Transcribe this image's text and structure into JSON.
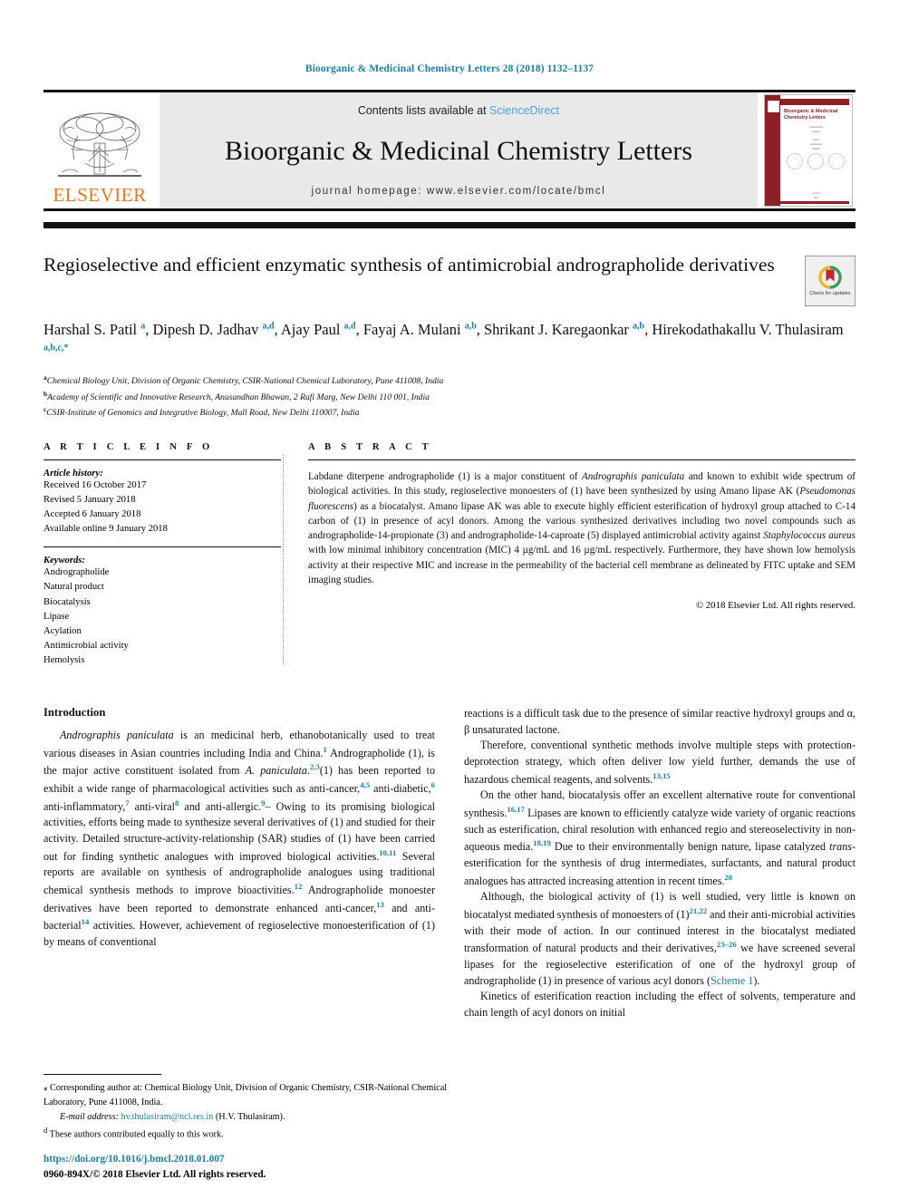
{
  "running_head": "Bioorganic & Medicinal Chemistry Letters 28 (2018) 1132–1137",
  "masthead": {
    "contents_prefix": "Contents lists available at ",
    "sciencedirect": "ScienceDirect",
    "journal_title": "Bioorganic & Medicinal Chemistry Letters",
    "homepage": "journal homepage: www.elsevier.com/locate/bmcl",
    "publisher_wordmark": "ELSEVIER",
    "publisher_color": "#E87722",
    "cover": {
      "title": "Bioorganic & Medicinal Chemistry Letters",
      "accent_color": "#8d2024"
    }
  },
  "article": {
    "title": "Regioselective and efficient enzymatic synthesis of antimicrobial andrographolide derivatives",
    "crossmark_label": "Check for updates",
    "authors_html": "Harshal S. Patil <sup>a</sup>, Dipesh D. Jadhav <sup>a,d</sup>, Ajay Paul <sup>a,d</sup>, Fayaj A. Mulani <sup>a,b</sup>, Shrikant J. Karegaonkar <sup>a,b</sup>, Hirekodathakallu V. Thulasiram <sup>a,b,c,</sup><sup>*</sup>",
    "affiliations": [
      {
        "mark": "a",
        "text": "Chemical Biology Unit, Division of Organic Chemistry, CSIR-National Chemical Laboratory, Pune 411008, India"
      },
      {
        "mark": "b",
        "text": "Academy of Scientific and Innovative Research, Anusandhan Bhawan, 2 Rafi Marg, New Delhi 110 001, India"
      },
      {
        "mark": "c",
        "text": "CSIR-Institute of Genomics and Integrative Biology, Mall Road, New Delhi 110007, India"
      }
    ]
  },
  "article_info": {
    "heading": "A R T I C L E   I N F O",
    "history_label": "Article history:",
    "history": [
      "Received 16 October 2017",
      "Revised 5 January 2018",
      "Accepted 6 January 2018",
      "Available online 9 January 2018"
    ],
    "keywords_label": "Keywords:",
    "keywords": [
      "Andrographolide",
      "Natural product",
      "Biocatalysis",
      "Lipase",
      "Acylation",
      "Antimicrobial activity",
      "Hemolysis"
    ]
  },
  "abstract": {
    "heading": "A B S T R A C T",
    "body_html": "Labdane diterpene andrographolide (1) is a major constituent of <i>Andrographis paniculata</i> and known to exhibit wide spectrum of biological activities. In this study, regioselective monoesters of (1) have been synthesized by using Amano lipase AK (<i>Pseudomonas fluorescens</i>) as a biocatalyst. Amano lipase AK was able to execute highly efficient esterification of hydroxyl group attached to C-14 carbon of (1) in presence of acyl donors. Among the various synthesized derivatives including two novel compounds such as andrographolide-14-propionate (3) and andrographolide-14-caproate (5) displayed antimicrobial activity against <i>Staphylococcus aureus</i> with low minimal inhibitory concentration (MIC) 4 µg/mL and 16 µg/mL respectively. Furthermore, they have shown low hemolysis activity at their respective MIC and increase in the permeability of the bacterial cell membrane as delineated by FITC uptake and SEM imaging studies.",
    "copyright": "© 2018 Elsevier Ltd. All rights reserved."
  },
  "body": {
    "section_heading": "Introduction",
    "left_paragraphs_html": [
      "<i>Andrographis paniculata</i> is an medicinal herb, ethanobotanically used to treat various diseases in Asian countries including India and China.<span class=\"ref\">1</span> Andrographolide (1), is the major active constituent isolated from <i>A. paniculata</i>.<span class=\"ref\">2,3</span>(1) has been reported to exhibit a wide range of pharmacological activities such as anti-cancer,<span class=\"ref\">4,5</span> anti-diabetic,<span class=\"ref\">6</span> anti-inflammatory,<span class=\"ref\">7</span> anti-viral<span class=\"ref\">8</span> and anti-allergic.<span class=\"ref\">9</span>– Owing to its promising biological activities, efforts being made to synthesize several derivatives of (1) and studied for their activity. Detailed structure-activity-relationship (SAR) studies of (1) have been carried out for finding synthetic analogues with improved biological activities.<span class=\"ref\">10,11</span> Several reports are available on synthesis of andrographolide analogues using traditional chemical synthesis methods to improve bioactivities.<span class=\"ref\">12</span> Andrographolide monoester derivatives have been reported to demonstrate enhanced anti-cancer,<span class=\"ref\">13</span> and anti-bacterial<span class=\"ref\">14</span> activities. However, achievement of regioselective monoesterification of (1) by means of conventional"
    ],
    "right_paragraphs_html": [
      "reactions is a difficult task due to the presence of similar reactive hydroxyl groups and α, β unsaturated lactone.",
      "Therefore, conventional synthetic methods involve multiple steps with protection-deprotection strategy, which often deliver low yield further, demands the use of hazardous chemical reagents, and solvents.<span class=\"ref\">13,15</span>",
      "On the other hand, biocatalysis offer an excellent alternative route for conventional synthesis.<span class=\"ref\">16,17</span> Lipases are known to efficiently catalyze wide variety of organic reactions such as esterification, chiral resolution with enhanced regio and stereoselectivity in non-aqueous media.<span class=\"ref\">18,19</span> Due to their environmentally benign nature, lipase catalyzed <i>trans</i>-esterification for the synthesis of drug intermediates, surfactants, and natural product analogues has attracted increasing attention in recent times.<span class=\"ref\">20</span>",
      "Although, the biological activity of (1) is well studied, very little is known on biocatalyst mediated synthesis of monoesters of (1)<span class=\"ref\">21,22</span> and their anti-microbial activities with their mode of action. In our continued interest in the biocatalyst mediated transformation of natural products and their derivatives,<span class=\"ref\">23–26</span> we have screened several lipases for the regioselective esterification of one of the hydroxyl group of andrographolide (1) in presence of various acyl donors (<span class=\"lnk\">Scheme 1</span>).",
      "Kinetics of esterification reaction including the effect of solvents, temperature and chain length of acyl donors on initial"
    ]
  },
  "footnotes": {
    "corresponding_html": "<span class=\"fn-sym\">⁎</span> Corresponding author at: Chemical Biology Unit, Division of Organic Chemistry, CSIR-National Chemical Laboratory, Pune 411008, India.",
    "email_html": "<span class=\"fn-italic\">E-mail address:</span> <span class=\"lnk\">hv.thulasiram@ncl.res.in</span> (H.V. Thulasiram).",
    "equal_contrib_html": "<sup>d</sup> These authors contributed equally to this work."
  },
  "footer": {
    "doi": "https://doi.org/10.1016/j.bmcl.2018.01.007",
    "issn_line": "0960-894X/© 2018 Elsevier Ltd. All rights reserved."
  }
}
